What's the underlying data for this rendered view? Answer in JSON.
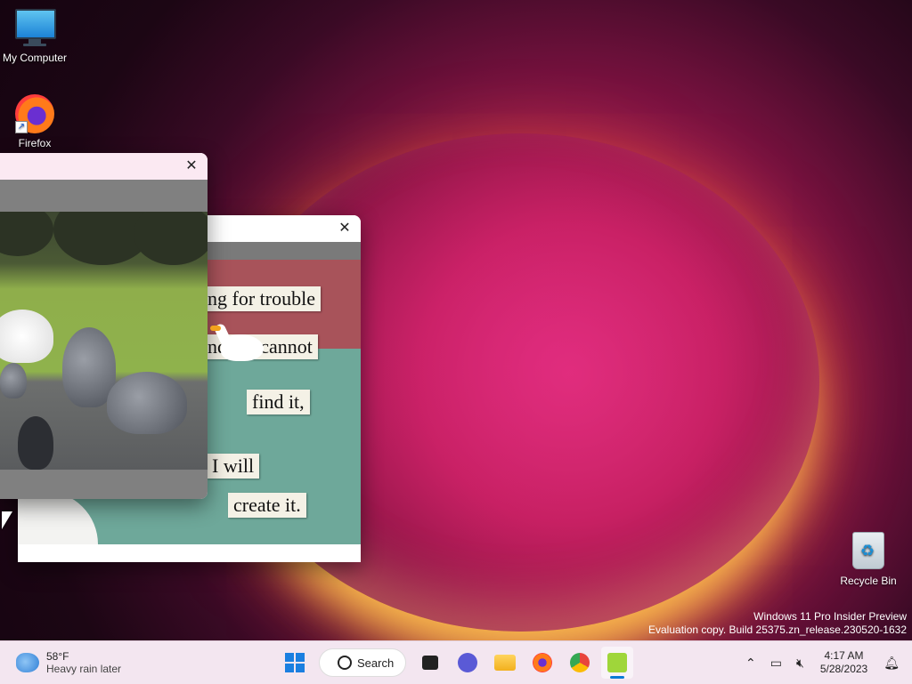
{
  "desktop": {
    "icons": [
      {
        "label": "My Computer"
      },
      {
        "label": "Firefox"
      },
      {
        "label": "Recycle Bin"
      }
    ]
  },
  "poem_window": {
    "lines": [
      "ng for trouble",
      "nd if I cannot",
      "find it,",
      "I will",
      "create it."
    ]
  },
  "watermark": {
    "line1": "Windows 11 Pro Insider Preview",
    "line2": "Evaluation copy. Build 25375.zn_release.230520-1632"
  },
  "taskbar": {
    "weather": {
      "temp": "58°F",
      "desc": "Heavy rain later"
    },
    "search_label": "Search",
    "clock": {
      "time": "4:17 AM",
      "date": "5/28/2023"
    }
  },
  "colors": {
    "accent": "#1a7fe0",
    "title_bar": "#fbe9f2"
  }
}
